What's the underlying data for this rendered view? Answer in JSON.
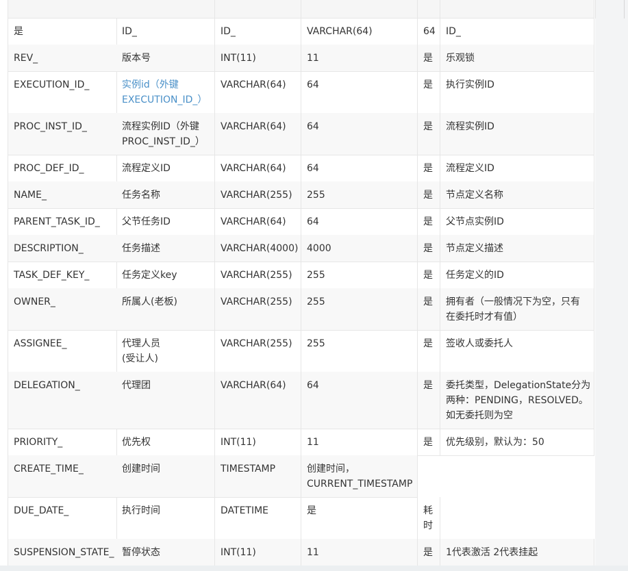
{
  "table": {
    "rows": [
      {
        "cells": [
          "是",
          "ID_",
          "ID_",
          "VARCHAR(64)",
          "64",
          "ID_"
        ]
      },
      {
        "cells": [
          "REV_",
          "版本号",
          "INT(11)",
          "11",
          "是",
          "乐观锁"
        ]
      },
      {
        "cells": [
          "EXECUTION_ID_",
          "实例id（外键\nEXECUTION_ID_）",
          "VARCHAR(64)",
          "64",
          "是",
          "执行实例ID"
        ]
      },
      {
        "cells": [
          "PROC_INST_ID_",
          "流程实例ID（外键\nPROC_INST_ID_）",
          "VARCHAR(64)",
          "64",
          "是",
          "流程实例ID"
        ]
      },
      {
        "cells": [
          "PROC_DEF_ID_",
          "流程定义ID",
          "VARCHAR(64)",
          "64",
          "是",
          "流程定义ID"
        ]
      },
      {
        "cells": [
          "NAME_",
          "任务名称",
          "VARCHAR(255)",
          "255",
          "是",
          "节点定义名称"
        ]
      },
      {
        "cells": [
          "PARENT_TASK_ID_",
          "父节任务ID",
          "VARCHAR(64)",
          "64",
          "是",
          "父节点实例ID"
        ]
      },
      {
        "cells": [
          "DESCRIPTION_",
          "任务描述",
          "VARCHAR(4000)",
          "4000",
          "是",
          "节点定义描述"
        ]
      },
      {
        "cells": [
          "TASK_DEF_KEY_",
          "任务定义key",
          "VARCHAR(255)",
          "255",
          "是",
          "任务定义的ID"
        ]
      },
      {
        "cells": [
          "OWNER_",
          "所属人(老板)",
          "VARCHAR(255)",
          "255",
          "是",
          "拥有者（一般情况下为空，只有\n在委托时才有值）"
        ]
      },
      {
        "cells": [
          "ASSIGNEE_",
          "代理人员\n(受让人)",
          "VARCHAR(255)",
          "255",
          "是",
          "签收人或委托人"
        ]
      },
      {
        "cells": [
          "DELEGATION_",
          "代理团",
          "VARCHAR(64)",
          "64",
          "是",
          "委托类型，DelegationState分为\n两种：PENDING，RESOLVED。\n如无委托则为空"
        ]
      },
      {
        "cells": [
          "PRIORITY_",
          "优先权",
          "INT(11)",
          "11",
          "是",
          "优先级别，默认为：50"
        ]
      },
      {
        "cells": [
          "CREATE_TIME_",
          "创建时间",
          "TIMESTAMP",
          "创建时间，\nCURRENT_TIMESTAMP"
        ]
      },
      {
        "cells": [
          "DUE_DATE_",
          "执行时间",
          "DATETIME",
          "是",
          "耗\n时"
        ]
      },
      {
        "cells": [
          "SUSPENSION_STATE_",
          "暂停状态",
          "INT(11)",
          "11",
          "是",
          "1代表激活 2代表挂起"
        ]
      }
    ]
  },
  "colors": {
    "link": "#4a90c8",
    "border": "#e6e6e6",
    "zebra": "#f8f8f8"
  }
}
